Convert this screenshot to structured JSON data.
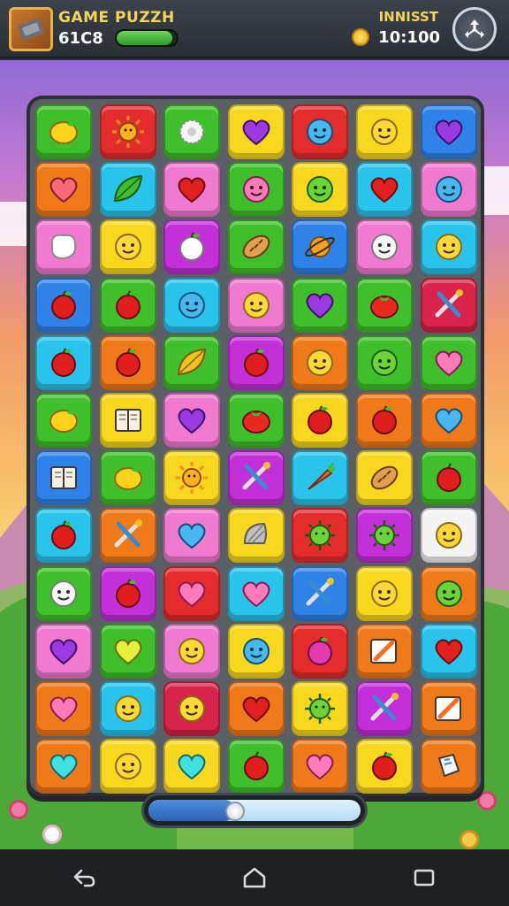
{
  "hud": {
    "title": "GAME PUZZH",
    "score": "61C8",
    "energy_fraction": 0.92,
    "right_title": "INNISST",
    "coins": "10:100",
    "menu_icon": "arrows-icon"
  },
  "progress": {
    "fraction": 0.41
  },
  "colors": {
    "green": "#3fbf2a",
    "red": "#e52c2c",
    "yellow": "#f7d81e",
    "blue": "#2f83e8",
    "orange": "#f07a1a",
    "pink": "#f07ad0",
    "cyan": "#29c4ec",
    "magenta": "#c32fd8",
    "lime": "#a8de1f",
    "crimson": "#d8244a",
    "white": "#f4f4f4"
  },
  "grid": [
    [
      "green:lemon",
      "red:sun",
      "green:dandelion",
      "yellow:heart-purple",
      "red:face-blue",
      "yellow:face",
      "blue:heart-purple"
    ],
    [
      "orange:heart",
      "cyan:leaf",
      "pink:heart-red",
      "green:face-pink",
      "yellow:face-green",
      "cyan:heart-red",
      "pink:face-blue"
    ],
    [
      "pink:white-blob",
      "yellow:face",
      "magenta:apple-white",
      "green:bread",
      "blue:planet",
      "pink:face-white",
      "cyan:face"
    ],
    [
      "blue:apple",
      "green:apple",
      "cyan:face-blue",
      "pink:face",
      "green:heart-purple",
      "green:tomato",
      "crimson:tools"
    ],
    [
      "cyan:apple",
      "orange:apple",
      "green:leaf-yellow",
      "magenta:apple",
      "orange:face",
      "green:face-green",
      "green:heart-pink"
    ],
    [
      "green:lemon",
      "yellow:book",
      "pink:heart-purple",
      "green:tomato",
      "yellow:apple",
      "orange:apple",
      "orange:heart-blue"
    ],
    [
      "blue:book",
      "green:lemon",
      "yellow:sun",
      "magenta:tools",
      "cyan:carrot",
      "yellow:bread",
      "green:apple"
    ],
    [
      "cyan:apple",
      "orange:tools",
      "pink:heart-blue",
      "yellow:shell",
      "red:virus",
      "magenta:virus",
      "white:face"
    ],
    [
      "green:face-white",
      "magenta:apple",
      "red:heart-pink",
      "cyan:heart-pink",
      "blue:tools",
      "yellow:face",
      "orange:face-green"
    ],
    [
      "pink:heart-purple",
      "green:heart-yellow",
      "pink:face",
      "yellow:face-blue",
      "red:apple-pink",
      "orange:pencil",
      "cyan:heart-red"
    ],
    [
      "orange:heart-pink",
      "cyan:face",
      "crimson:face",
      "orange:heart-red",
      "yellow:virus",
      "magenta:tools",
      "orange:pencil"
    ],
    [
      "orange:heart-cyan",
      "yellow:face",
      "yellow:heart-cyan",
      "green:apple",
      "orange:heart-pink",
      "yellow:apple",
      "orange:box"
    ]
  ],
  "navbar": {
    "back_icon": "back-icon",
    "home_icon": "home-icon",
    "recents_icon": "recents-icon"
  }
}
